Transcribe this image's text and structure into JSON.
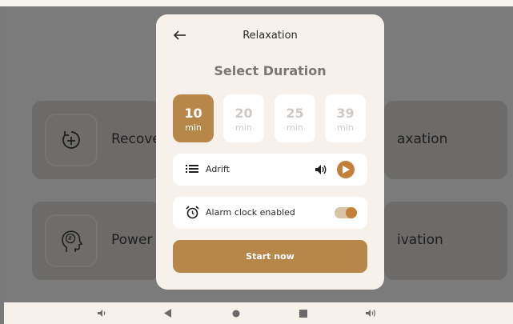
{
  "background_cards": [
    {
      "label": "Recove",
      "icon": "timer-plus-icon"
    },
    {
      "label": "axation",
      "icon": ""
    },
    {
      "label": "Power",
      "icon": "head-sleep-icon"
    },
    {
      "label": "ivation",
      "icon": ""
    }
  ],
  "modal": {
    "title": "Relaxation",
    "section_title": "Select Duration",
    "durations": [
      {
        "value": "10",
        "unit": "min",
        "selected": true
      },
      {
        "value": "20",
        "unit": "min",
        "selected": false
      },
      {
        "value": "25",
        "unit": "min",
        "selected": false
      },
      {
        "value": "39",
        "unit": "min",
        "selected": false
      }
    ],
    "sound": {
      "name": "Adrift",
      "icon": "list-icon"
    },
    "alarm": {
      "label": "Alarm clock enabled",
      "enabled": true,
      "icon": "alarm-clock-icon"
    },
    "start_label": "Start now"
  },
  "navbar": {
    "items": [
      "volume-down-icon",
      "back-icon",
      "home-icon",
      "recents-icon",
      "volume-up-icon"
    ]
  },
  "colors": {
    "accent": "#b7874a",
    "accent_dark": "#c4803a",
    "modal_bg": "#f7f1eb"
  }
}
